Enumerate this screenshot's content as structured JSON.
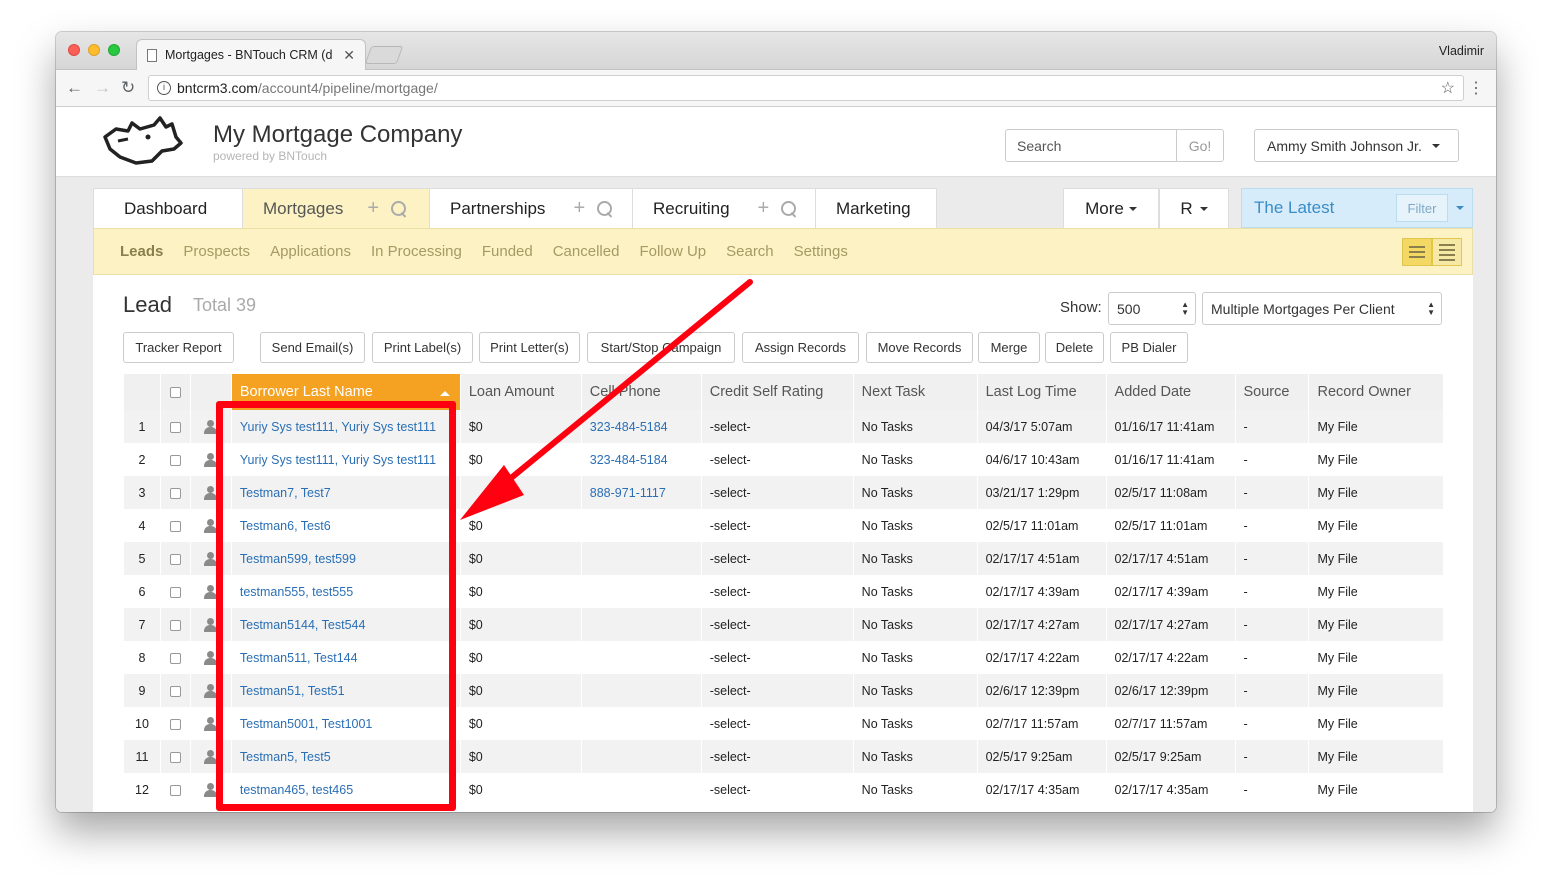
{
  "browser": {
    "tab_title": "Mortgages - BNTouch CRM (d",
    "profile_name": "Vladimir",
    "url_host": "bntcrm3.com",
    "url_path": "/account4/pipeline/mortgage/"
  },
  "header": {
    "company_name": "My Mortgage Company",
    "powered_by": "powered by BNTouch",
    "search_placeholder": "Search",
    "go_label": "Go!",
    "user_name": "Ammy Smith Johnson Jr."
  },
  "module_tabs": [
    {
      "label": "Dashboard"
    },
    {
      "label": "Mortgages"
    },
    {
      "label": "Partnerships"
    },
    {
      "label": "Recruiting"
    },
    {
      "label": "Marketing"
    }
  ],
  "more_label": "More",
  "r_label": "R",
  "latest": {
    "label": "The Latest",
    "filter_label": "Filter"
  },
  "subnav": [
    "Leads",
    "Prospects",
    "Applications",
    "In Processing",
    "Funded",
    "Cancelled",
    "Follow Up",
    "Search",
    "Settings"
  ],
  "lead": {
    "title": "Lead",
    "total": "Total 39"
  },
  "show": {
    "label": "Show:",
    "value": "500",
    "mode": "Multiple Mortgages Per Client"
  },
  "actions": [
    "Tracker Report",
    "Send Email(s)",
    "Print Label(s)",
    "Print Letter(s)",
    "Start/Stop Campaign",
    "Assign Records",
    "Move Records",
    "Merge",
    "Delete",
    "PB Dialer"
  ],
  "columns": [
    "Borrower Last Name",
    "Loan Amount",
    "Cell Phone",
    "Credit Self Rating",
    "Next Task",
    "Last Log Time",
    "Added Date",
    "Source",
    "Record Owner"
  ],
  "rows": [
    {
      "n": "1",
      "name": "Yuriy Sys test111, Yuriy Sys test111",
      "amount": "$0",
      "phone": "323-484-5184",
      "credit": "-select-",
      "task": "No Tasks",
      "log": "04/3/17 5:07am",
      "added": "01/16/17 11:41am",
      "source": "-",
      "owner": "My File"
    },
    {
      "n": "2",
      "name": "Yuriy Sys test111, Yuriy Sys test111",
      "amount": "$0",
      "phone": "323-484-5184",
      "credit": "-select-",
      "task": "No Tasks",
      "log": "04/6/17 10:43am",
      "added": "01/16/17 11:41am",
      "source": "-",
      "owner": "My File"
    },
    {
      "n": "3",
      "name": "Testman7, Test7",
      "amount": "",
      "phone": "888-971-1117",
      "credit": "-select-",
      "task": "No Tasks",
      "log": "03/21/17 1:29pm",
      "added": "02/5/17 11:08am",
      "source": "-",
      "owner": "My File"
    },
    {
      "n": "4",
      "name": "Testman6, Test6",
      "amount": "$0",
      "phone": "",
      "credit": "-select-",
      "task": "No Tasks",
      "log": "02/5/17 11:01am",
      "added": "02/5/17 11:01am",
      "source": "-",
      "owner": "My File"
    },
    {
      "n": "5",
      "name": "Testman599, test599",
      "amount": "$0",
      "phone": "",
      "credit": "-select-",
      "task": "No Tasks",
      "log": "02/17/17 4:51am",
      "added": "02/17/17 4:51am",
      "source": "-",
      "owner": "My File"
    },
    {
      "n": "6",
      "name": "testman555, test555",
      "amount": "$0",
      "phone": "",
      "credit": "-select-",
      "task": "No Tasks",
      "log": "02/17/17 4:39am",
      "added": "02/17/17 4:39am",
      "source": "-",
      "owner": "My File"
    },
    {
      "n": "7",
      "name": "Testman5144, Test544",
      "amount": "$0",
      "phone": "",
      "credit": "-select-",
      "task": "No Tasks",
      "log": "02/17/17 4:27am",
      "added": "02/17/17 4:27am",
      "source": "-",
      "owner": "My File"
    },
    {
      "n": "8",
      "name": "Testman511, Test144",
      "amount": "$0",
      "phone": "",
      "credit": "-select-",
      "task": "No Tasks",
      "log": "02/17/17 4:22am",
      "added": "02/17/17 4:22am",
      "source": "-",
      "owner": "My File"
    },
    {
      "n": "9",
      "name": "Testman51, Test51",
      "amount": "$0",
      "phone": "",
      "credit": "-select-",
      "task": "No Tasks",
      "log": "02/6/17 12:39pm",
      "added": "02/6/17 12:39pm",
      "source": "-",
      "owner": "My File"
    },
    {
      "n": "10",
      "name": "Testman5001, Test1001",
      "amount": "$0",
      "phone": "",
      "credit": "-select-",
      "task": "No Tasks",
      "log": "02/7/17 11:57am",
      "added": "02/7/17 11:57am",
      "source": "-",
      "owner": "My File"
    },
    {
      "n": "11",
      "name": "Testman5, Test5",
      "amount": "$0",
      "phone": "",
      "credit": "-select-",
      "task": "No Tasks",
      "log": "02/5/17 9:25am",
      "added": "02/5/17 9:25am",
      "source": "-",
      "owner": "My File"
    },
    {
      "n": "12",
      "name": "testman465, test465",
      "amount": "$0",
      "phone": "",
      "credit": "-select-",
      "task": "No Tasks",
      "log": "02/17/17 4:35am",
      "added": "02/17/17 4:35am",
      "source": "-",
      "owner": "My File"
    }
  ],
  "colors": {
    "accent_orange": "#f5a122",
    "subnav_bg": "#fcf2c3",
    "link_blue": "#2a6fb5",
    "annotation_red": "#ff0010",
    "latest_blue": "#3a8dc7"
  },
  "icons": [
    "close-icon",
    "back-arrow-icon",
    "forward-arrow-icon",
    "reload-icon",
    "info-icon",
    "star-icon",
    "menu-dots-icon",
    "rhino-logo-icon",
    "plus-icon",
    "search-icon",
    "caret-down-icon",
    "list-view-icon",
    "detail-view-icon",
    "person-icon",
    "sort-up-icon"
  ]
}
